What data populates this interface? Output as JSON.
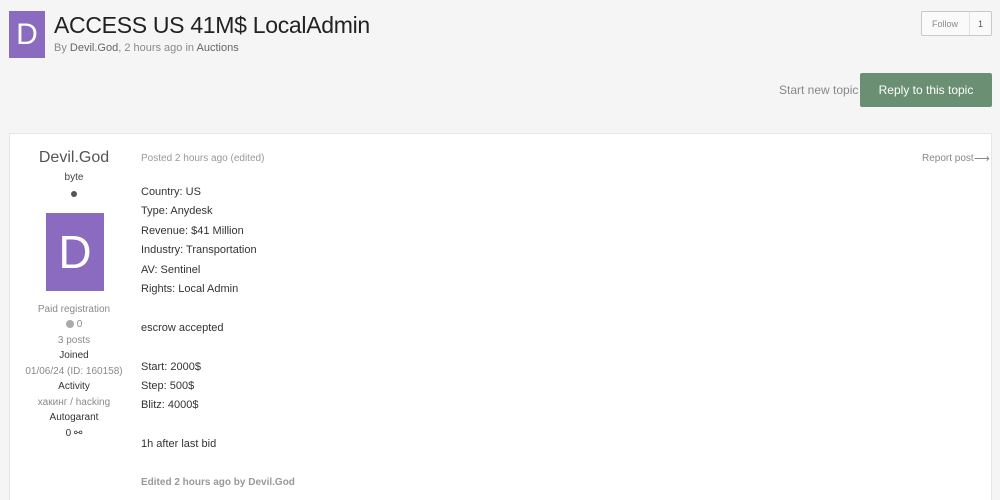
{
  "header": {
    "avatar_letter": "D",
    "title": "ACCESS US 41M$ LocalAdmin",
    "meta_by": "By",
    "author": "Devil.God",
    "meta_time": ", 2 hours ago in",
    "forum": "Auctions"
  },
  "follow": {
    "label": "Follow",
    "count": "1"
  },
  "actions": {
    "start_topic": "Start new topic",
    "reply": "Reply to this topic"
  },
  "author": {
    "name": "Devil.God",
    "rank": "byte",
    "avatar_letter": "D",
    "group": "Paid registration",
    "reputation": "0",
    "posts": "3 posts",
    "joined_label": "Joined",
    "joined_value": "01/06/24 (ID: 160158)",
    "activity_label": "Activity",
    "activity_value": "хакинг / hacking",
    "autogarant_label": "Autogarant",
    "autogarant_value": "0"
  },
  "post": {
    "date": "Posted 2 hours ago (edited)",
    "report": "Report post",
    "lines": [
      "Country: US",
      "Type: Anydesk",
      "Revenue: $41 Million",
      "Industry: Transportation",
      "AV: Sentinel",
      "Rights: Local Admin",
      "escrow accepted",
      "Start: 2000$",
      "Step: 500$",
      "Blitz: 4000$",
      "1h after last bid"
    ],
    "edited": "Edited 2 hours ago by Devil.God"
  },
  "icons": {
    "share": "share-icon",
    "autogarant": "handshake-icon"
  },
  "colors": {
    "avatar": "#8a6bbf",
    "reply_button": "#6b8f73"
  }
}
